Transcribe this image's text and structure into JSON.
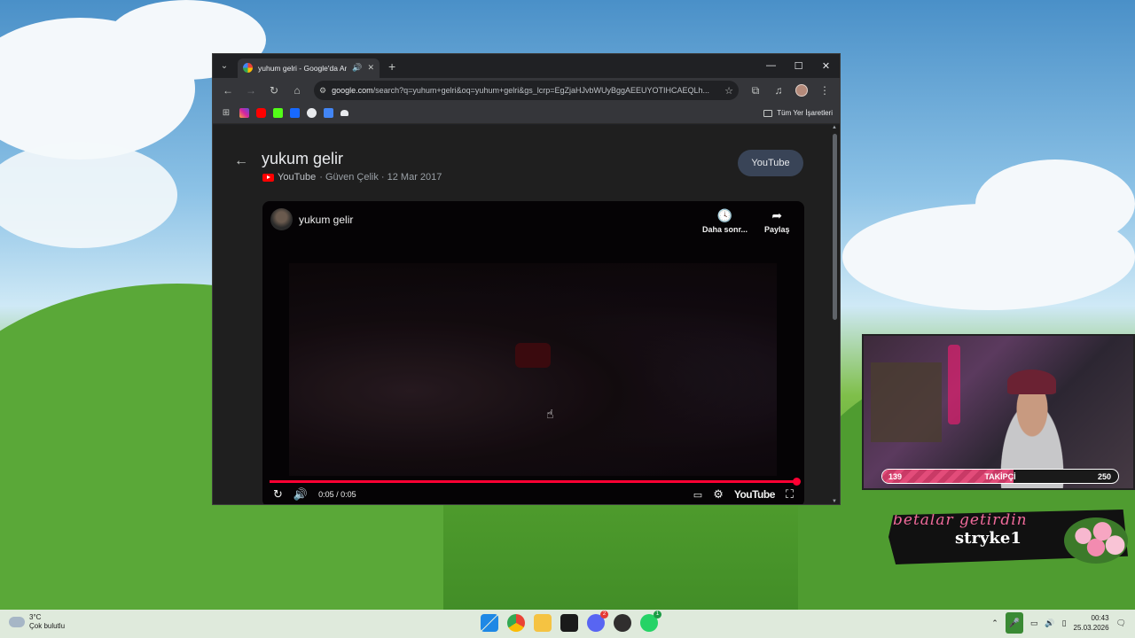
{
  "browser": {
    "tab_title": "yuhum gelri - Google'da Ara",
    "url_host": "google.com",
    "url_path": "/search?q=yuhum+gelri&oq=yuhum+gelri&gs_lcrp=EgZjaHJvbWUyBggAEEUYOTIHCAEQLh...",
    "bookmarks_folder": "Tüm Yer İşaretleri"
  },
  "video": {
    "title": "yukum gelir",
    "source": "YouTube",
    "meta": "· Güven Çelik · 12 Mar 2017",
    "youtube_button": "YouTube",
    "player_title": "yukum gelir",
    "watch_later": "Daha sonr...",
    "share": "Paylaş",
    "time": "0:05 / 0:05",
    "youtube_logo": "YouTube",
    "progress": 1.0
  },
  "overlay": {
    "follow_current": "139",
    "follow_label": "TAKİPÇİ",
    "follow_goal": "250",
    "banner_script": "betalar getirdin",
    "banner_name": "stryke1"
  },
  "taskbar": {
    "temperature": "3°C",
    "weather": "Çok bulutlu",
    "time": "00:43",
    "date": "25.03.2026",
    "discord_badge": "2",
    "whatsapp_badge": "1"
  }
}
